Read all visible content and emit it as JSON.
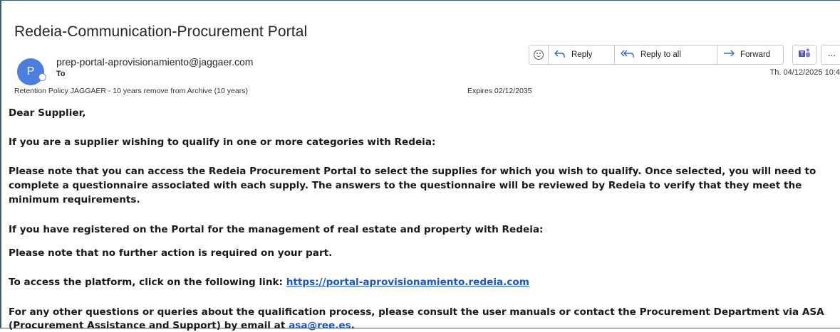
{
  "email": {
    "subject": "Redeia-Communication-Procurement Portal",
    "avatar_initial": "P",
    "sender": "prep-portal-aprovisionamiento@jaggaer.com",
    "to_label": "To",
    "retention_policy": "Retention Policy  JAGGAER  - 10 years remove from Archive (10 years)",
    "expires": "Expires 02/12/2035",
    "date": "Th. 04/12/2025 10:4"
  },
  "toolbar": {
    "reply_label": "Reply",
    "reply_all_label": "Reply to all",
    "forward_label": "Forward",
    "more_label": "···"
  },
  "body": {
    "greeting": "Dear Supplier,",
    "p1": "If you are a supplier wishing to qualify in one or more categories with Redeia:",
    "p2_line1": "Please note that you can access the Redeia Procurement Portal to select the supplies for which you wish to qualify. Once selected, you will need to",
    "p2_line2": "complete a questionnaire associated with each supply. The answers to the questionnaire will be reviewed by Redeia to verify that they meet the",
    "p2_line3": "minimum requirements.",
    "p3": "If you have registered on the Portal for the management of real estate and property with Redeia:",
    "p4": "Please note that no further action is required on your part.",
    "p5_prefix": "To access the platform, click on the following link: ",
    "p5_link": "https://portal-aprovisionamiento.redeia.com",
    "p6_line1": "For any other questions or queries about the qualification process, please consult the user manuals or contact the Procurement Department via ASA",
    "p6_line2_prefix": "(Procurement Assistance and Support) by email at ",
    "p6_email": "asa@ree.es",
    "p6_suffix": "."
  },
  "colors": {
    "accent": "#2b6cd6",
    "link": "#1a55c9",
    "avatar": "#4a7fe0",
    "frame_border": "#3c5a7a"
  },
  "icons": [
    "emoji-icon",
    "reply-icon",
    "reply-all-icon",
    "forward-icon",
    "teams-icon",
    "more-icon"
  ]
}
